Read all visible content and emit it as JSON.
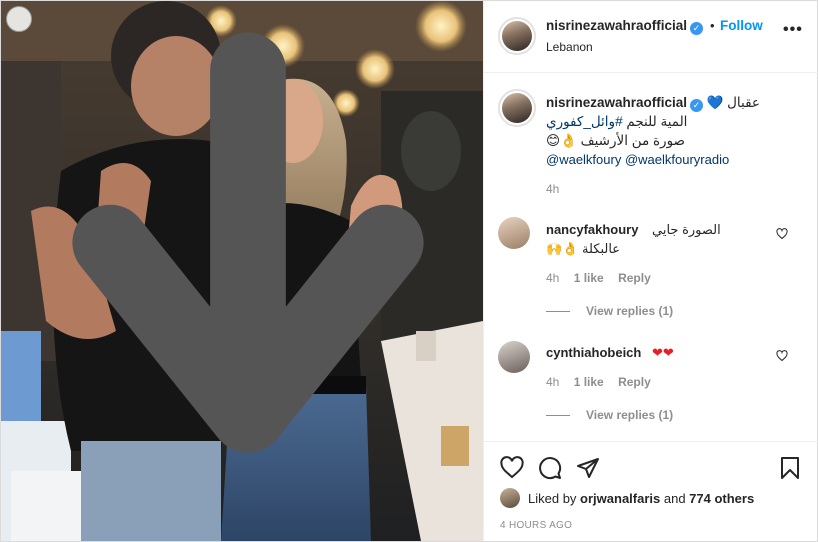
{
  "post": {
    "username": "nisrinezawahraofficial",
    "follow_label": "Follow",
    "dot": "•",
    "verified_mark": "✓",
    "location": "Lebanon",
    "more_label": "•••"
  },
  "caption": {
    "username": "nisrinezawahraofficial",
    "line1": "عقبال 💙",
    "line2_text": "المية للنجم ",
    "line2_tag": "#وائل_كفوري",
    "line3": "صورة من الأرشيف 👌😊",
    "line4": "@waelkfoury @waelkfouryradio",
    "time": "4h"
  },
  "comments": [
    {
      "username": "nancyfakhoury",
      "text_line1": "الصورة جايي",
      "text_line2": "عالبكلة 👌🙌",
      "time": "4h",
      "likes": "1 like",
      "reply": "Reply",
      "view_replies": "View replies (1)"
    },
    {
      "username": "cynthiahobeich",
      "text_line1": "❤❤",
      "time": "4h",
      "likes": "1 like",
      "reply": "Reply",
      "view_replies": "View replies (1)"
    }
  ],
  "likes": {
    "prefix": "Liked by ",
    "first_user": "orjwanalfaris",
    "middle": " and ",
    "others": "774 others"
  },
  "timestamp": "4 HOURS AGO",
  "icons": {
    "download": "download-icon",
    "like": "heart-outline-icon",
    "comment": "comment-icon",
    "share": "share-icon",
    "save": "bookmark-icon",
    "comment_like": "small-heart-icon"
  },
  "colors": {
    "follow_blue": "#0095f6",
    "verified_blue": "#3897f0",
    "tag_blue": "#00376b",
    "muted": "#8e8e8e",
    "heart_red": "#ed1c24"
  }
}
